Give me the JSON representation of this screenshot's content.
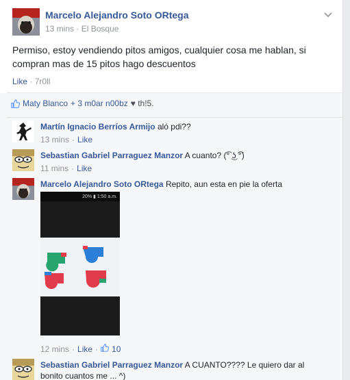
{
  "post": {
    "author": "Marcelo Alejandro Soto ORtega",
    "time": "13 mins",
    "location": "El Bosque",
    "text": "Permiso, estoy vendiendo pitos amigos, cualquier cosa me hablan, si compran mas de 15 pitos hago descuentos",
    "like_label": "Like",
    "reaction_tag": "7r0ll"
  },
  "likes_summary": {
    "names": "Maty Blanco",
    "others": "+ 3 m0ar n00bz",
    "heart_text": "♥ th!5."
  },
  "comments": [
    {
      "author": "Martín Ignacio Berríos Armijo",
      "text": "aló pdi??",
      "time": "13 mins",
      "like_label": "Like"
    },
    {
      "author": "Sebastian Gabriel Parraguez Manzor",
      "text": "A cuanto? (͡° ͜ʖ ͡°)",
      "time": "11 mins",
      "like_label": "Like"
    },
    {
      "author": "Marcelo Alejandro Soto ORtega",
      "text": "Repito, aun esta en pie la oferta",
      "time": "12 mins",
      "like_label": "Like",
      "like_count": "10",
      "photo_status": "20% ▮ 1:50 a.m."
    },
    {
      "author": "Sebastian Gabriel Parraguez Manzor",
      "text": "A CUANTO???? Le quiero dar al",
      "text_line2": "bonito cuantos me ... ^)"
    }
  ],
  "separator": "·",
  "colors": {
    "link": "#365899",
    "meta": "#90949c",
    "background": "#e9ebee",
    "comments_bg": "#f6f7f9"
  }
}
